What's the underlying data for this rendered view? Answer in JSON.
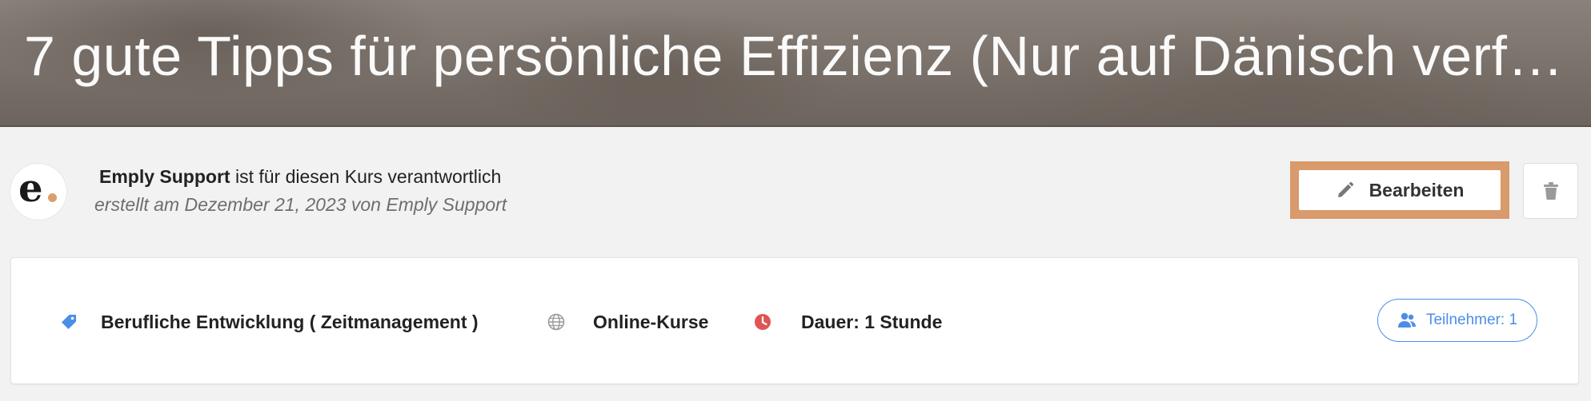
{
  "hero": {
    "title": "7 gute Tipps für persönliche Effizienz (Nur auf Dänisch verfüg..."
  },
  "owner": {
    "avatar_letter": "e",
    "name": "Emply  Support",
    "responsibility_text": "ist für diesen Kurs verantwortlich",
    "created_text": "erstellt am Dezember 21, 2023 von Emply  Support"
  },
  "actions": {
    "edit_label": "Bearbeiten",
    "edit_icon": "pencil-icon",
    "delete_icon": "trash-icon"
  },
  "course_details": {
    "category_icon": "tag-icon",
    "category": "Berufliche Entwicklung  ( Zeitmanagement  )",
    "format_icon": "globe-icon",
    "format": "Online-Kurse",
    "duration_icon": "clock-icon",
    "duration": "Dauer: 1 Stunde",
    "participants_icon": "users-icon",
    "participants_label": "Teilnehmer: 1"
  },
  "colors": {
    "highlight": "#d99a6c",
    "accent_blue": "#4a8fe7",
    "clock_red": "#e05454",
    "avatar_dot": "#d9a06b"
  }
}
